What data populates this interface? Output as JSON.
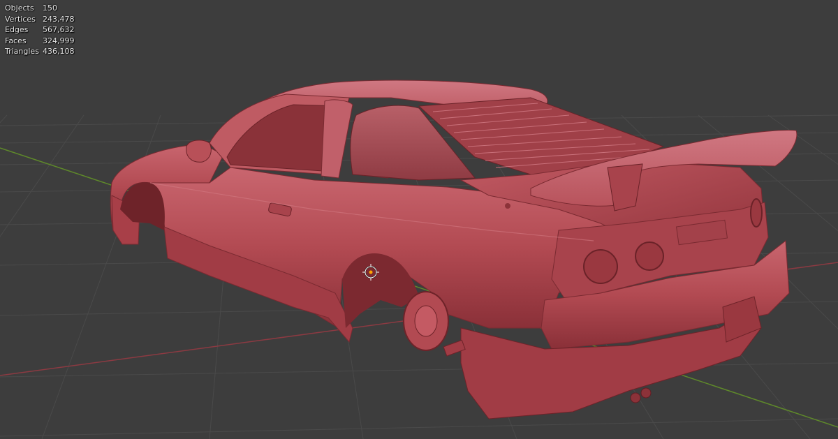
{
  "viewport": {
    "background": "#3d3d3d",
    "grid_color": "#4a4a4a",
    "x_axis_color": "#8c3a42",
    "y_axis_color": "#5f8a2a",
    "model_color": "#b2474f",
    "origin_marker": "object-origin-icon"
  },
  "stats": [
    {
      "label": "Objects",
      "value": "150"
    },
    {
      "label": "Vertices",
      "value": "243,478"
    },
    {
      "label": "Edges",
      "value": "567,632"
    },
    {
      "label": "Faces",
      "value": "324,999"
    },
    {
      "label": "Triangles",
      "value": "436,108"
    }
  ]
}
